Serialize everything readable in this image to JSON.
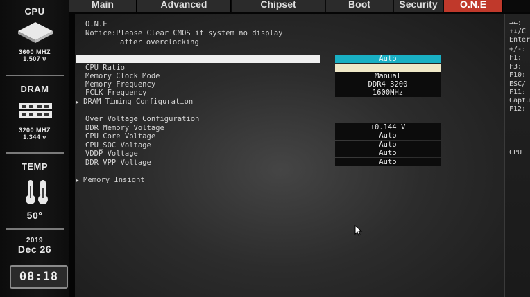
{
  "sidebar": {
    "cpu_label": "CPU",
    "cpu_speed": "3600 MHZ",
    "cpu_voltage": "1.507 ν",
    "dram_label": "DRAM",
    "dram_speed": "3200 MHZ",
    "dram_voltage": "1.344 ν",
    "temp_label": "TEMP",
    "temp_value": "50°",
    "year": "2019",
    "date": "Dec 26",
    "time": "08:18"
  },
  "tabs": [
    "Main",
    "Advanced",
    "Chipset",
    "Boot",
    "Security",
    "O.N.E"
  ],
  "active_tab": "O.N.E",
  "main": {
    "section_title": "O.N.E",
    "notice_line1": "Notice:Please Clear CMOS if system no display",
    "notice_line2": "after overclocking",
    "settings": [
      {
        "label": "CPU Ratio",
        "value": "Auto"
      },
      {
        "label": "Memory Clock Mode",
        "value": "Manual"
      },
      {
        "label": "Memory Frequency",
        "value": "DDR4 3200"
      },
      {
        "label": "FCLK Frequency",
        "value": "1600MHz"
      }
    ],
    "dram_timing": "DRAM Timing Configuration",
    "voltage_header": "Over Voltage Configuration",
    "voltages": [
      {
        "label": "DDR Memory Voltage",
        "value": "+0.144 V"
      },
      {
        "label": "CPU Core Voltage",
        "value": "Auto"
      },
      {
        "label": "CPU_SOC Voltage",
        "value": "Auto"
      },
      {
        "label": "VDDP Voltage",
        "value": "Auto"
      },
      {
        "label": "DDR VPP Voltage",
        "value": "Auto"
      }
    ],
    "memory_insight": "Memory Insight"
  },
  "help": {
    "keys": [
      "→←:",
      "↑↓/C",
      "Enter",
      "+/-:",
      "F1:",
      "F3:",
      "F10:",
      "ESC/",
      "F11:",
      "Captu",
      "F12:"
    ],
    "footer": "CPU"
  },
  "colors": {
    "active_tab": "#c0392b",
    "selected_value": "#19b0c4",
    "value_box": "#0c0c0c"
  }
}
